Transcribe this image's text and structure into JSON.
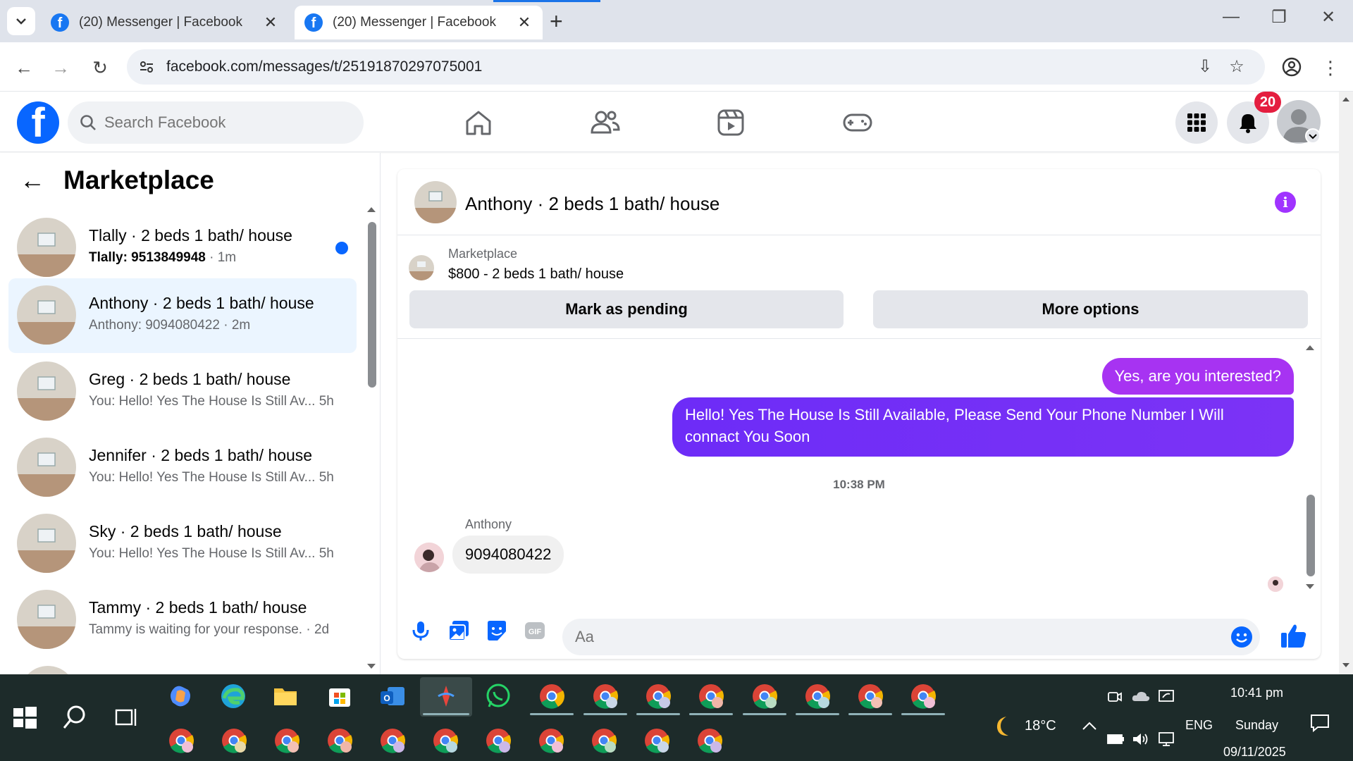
{
  "browser": {
    "tabs": [
      {
        "title": "(20) Messenger | Facebook"
      },
      {
        "title": "(20) Messenger | Facebook"
      }
    ],
    "url": "facebook.com/messages/t/25191870297075001"
  },
  "fb": {
    "search_placeholder": "Search Facebook",
    "notifications_count": "20"
  },
  "sidebar": {
    "title": "Marketplace",
    "conversations": [
      {
        "name": "Tlally · 2 beds 1 bath/ house",
        "snippet": "Tlally: 9513849948",
        "time": " · 1m",
        "unread": true
      },
      {
        "name": "Anthony · 2 beds 1 bath/ house",
        "snippet": "Anthony: 9094080422 · 2m",
        "active": true
      },
      {
        "name": "Greg · 2 beds 1 bath/ house",
        "snippet": "You: Hello! Yes The House Is Still Av...  5h"
      },
      {
        "name": "Jennifer · 2 beds 1 bath/ house",
        "snippet": "You: Hello! Yes The House Is Still Av...  5h"
      },
      {
        "name": "Sky · 2 beds 1 bath/ house",
        "snippet": "You: Hello! Yes The House Is Still Av...  5h"
      },
      {
        "name": "Tammy · 2 beds 1 bath/ house",
        "snippet": "Tammy is waiting for your response. · 2d"
      }
    ]
  },
  "chat": {
    "title": "Anthony · 2 beds 1 bath/ house",
    "marketplace_label": "Marketplace",
    "listing": "$800 - 2 beds 1 bath/ house",
    "mark_pending": "Mark as pending",
    "more_options": "More options",
    "messages": [
      {
        "from": "me",
        "text": "Yes, are you interested?"
      },
      {
        "from": "me",
        "text": "Hello! Yes The House  Is Still Available, Please Send Your Phone Number I Will connact You Soon"
      },
      {
        "from": "them",
        "sender": "Anthony",
        "text": "9094080422"
      }
    ],
    "timestamp": "10:38 PM",
    "composer_placeholder": "Aa"
  },
  "taskbar": {
    "weather": "18°C",
    "lang": "ENG",
    "time": "10:41 pm",
    "day": "Sunday",
    "date": "09/11/2025"
  },
  "colors": {
    "fb_blue": "#0866ff",
    "bubble_purple": "#7b2cf9",
    "active_row": "#ebf5ff"
  }
}
